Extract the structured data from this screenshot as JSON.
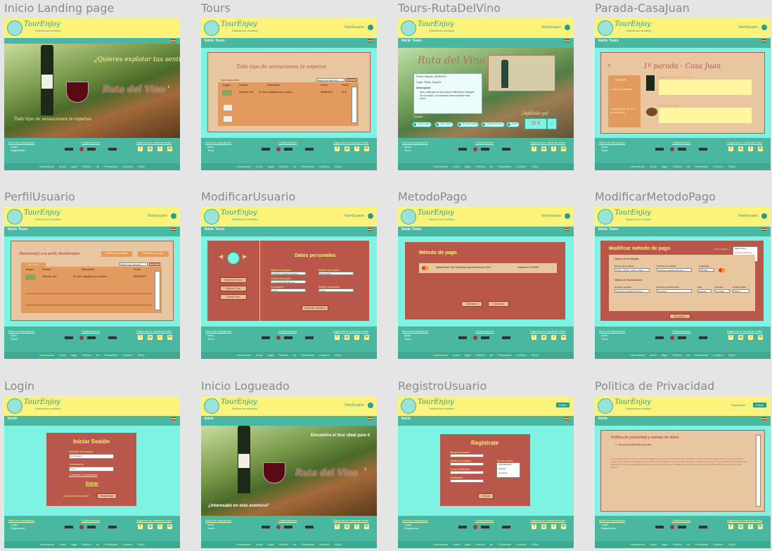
{
  "frames": [
    {
      "title": "Inicio Landing page"
    },
    {
      "title": "Tours"
    },
    {
      "title": "Tours-RutaDelVino"
    },
    {
      "title": "Parada-CasaJuan"
    },
    {
      "title": "PerfilUsuario"
    },
    {
      "title": "ModificarUsuario"
    },
    {
      "title": "MetodoPago"
    },
    {
      "title": "ModificarMetodoPago"
    },
    {
      "title": "Login"
    },
    {
      "title": "Inicio Logueado"
    },
    {
      "title": "RegistroUsuario"
    },
    {
      "title": "Politica de Privacidad"
    }
  ],
  "app": {
    "brand": "TourEnjoy",
    "tagline": "Disfruta tus sentidos",
    "username": "NomUsuario",
    "entrar": "Entrar",
    "registrarse": "Registrarse",
    "nav_inicio": "Inicio",
    "nav_tours": "Tours"
  },
  "footer": {
    "menu_title": "Menú de navegación",
    "menu_login": "Login",
    "menu_register": "Registrarse",
    "menu_inicio": "Inicio",
    "menu_tours": "Tours",
    "collab_title": "Colaboradores",
    "social_title": "Síguenos en nuestras redes",
    "legal": "Información Aviso legal Política de Privacidad Cookies FAQs"
  },
  "landing": {
    "headline": "¿Quieres explotar tus sentidos?",
    "ruta": "Ruta del Vino",
    "sub": "Todo tipo de sensaciones te esperan"
  },
  "tours": {
    "title": "Todo tipo de sensaciones te esperan",
    "tab": "Tours disponibles",
    "search": "Buscar tour deportivo",
    "search_btn": "Buscar",
    "col_imagen": "Imagen",
    "col_nombre": "Nombre",
    "col_desc": "Descripción",
    "col_fecha": "Fecha",
    "col_precio": "Precio",
    "row_nombre": "Ruta del vino",
    "row_desc": "En este magnífico tour podrás...",
    "row_fecha": "08/08/2021",
    "row_precio": "32 €"
  },
  "rutavino": {
    "title": "Ruta del Vino",
    "fecha": "Fecha: Sábado, 08/08/2021",
    "lugar": "Lugar: Toledo, España",
    "desc_label": "Descripción:",
    "desc": "Van a disfrutar de una cata en diferentes bodegas de la ciudad. Los sentidos nunca estarán más vivos...",
    "paradas": "Paradas:",
    "stops": [
      "Casa Juan",
      "Vino Tinto",
      "Buenas uvas",
      "Viñeda el buco",
      "Mura"
    ],
    "aplicable": "¡Aplícalo ya!",
    "price": "32 €"
  },
  "casajuan": {
    "title": "1ª parada - Casa Juan",
    "incluye": "Incluye",
    "inc1": "1 copa por persona",
    "inc2": "Productos con un 10% de descuento",
    "prod1": "Prosecco Cabrera 2016",
    "prod2": "Queso Curado"
  },
  "perfil": {
    "welcome": "Bienvenid@ a tu perfil, NomUsuario",
    "btn_datos": "Datos personales",
    "btn_pago": "Método de pago",
    "tab": "Mis Tours",
    "search": "Buscar tour deportivo",
    "search_btn": "Buscar",
    "col_imagen": "Imagen",
    "col_nombre": "Nombre",
    "col_desc": "Descripción",
    "col_fecha": "Fecha",
    "row_nombre": "Ruta del vino",
    "row_desc": "En este magnífico tour podrás...",
    "row_fecha": "08/08/2021"
  },
  "modusuario": {
    "title": "Datos personales",
    "btn_foto": "Modificar Foto",
    "btn_borrar": "Borrar Foto",
    "btn_subir": "Subir Foto",
    "f1": "Nombre completo",
    "v1": "Apellido1 Apellido2 Nombre",
    "f2": "Nombre de usuario",
    "v2": "NomUsuario",
    "f3": "Correo electrónico",
    "v3": "nomusuario@gmail.com",
    "f4": "Contraseña",
    "v4": "••••••••",
    "f5": "Repetir contraseña",
    "v5": "••••••••",
    "btn_guardar": "Guardar cambios"
  },
  "metodopago": {
    "title": "Método de pago",
    "card": "MasterCard • 46 / Expiración que termina en 2314",
    "exp": "Caduca el: 07/2022",
    "btn_eliminar": "Eliminar",
    "btn_guardar": "Guardar"
  },
  "modpago": {
    "title": "Modificar método de pago",
    "tipo": "Tipo de tarjeta",
    "opt1": "MasterCard",
    "opt2": "American Express",
    "opt3": "PayPal",
    "sec1": "Datos de la tarjeta",
    "f1": "Número de la tarjeta",
    "v1": "XXXX - XXXX - XXXX - 2314",
    "f2": "Nombre en la tarjeta",
    "v2": "Apellido1 Apellido2 Nombre",
    "f3": "Caducidad",
    "v3": "07/2022",
    "sec2": "Datos de facturación",
    "g1": "Nombre completo",
    "w1": "Apellido1 Apellido2 Nombre",
    "g2": "Dirección de facturación",
    "w2": "Dirección",
    "g3": "País",
    "w3": "España",
    "g4": "Provincia",
    "w4": "Granada",
    "g5": "Código postal",
    "w5": "18014",
    "btn": "Modificar"
  },
  "login": {
    "title": "Iniciar Sesión",
    "user_label": "Nombre de usuario",
    "user_val": "NomUsuario",
    "pass_label": "Contraseña",
    "pass_val": "••••••••",
    "forgot": "¿Olvidaste tu contraseña?",
    "entrar": "Entrar",
    "noacc": "¿Aún no tienes cuenta?",
    "reg": "Regístrate"
  },
  "logueado": {
    "headline": "Encuentra el tour ideal para ti",
    "ruta": "Ruta del Vino",
    "sub": "¿Interesado en esta aventura?"
  },
  "registro": {
    "title": "Regístrate",
    "f1": "Nombre completo",
    "f2": "Nombre de usuario",
    "f3": "Correo electrónico",
    "f4": "Contraseña",
    "f5": "Tipo de usuario",
    "opt1": "Administrador",
    "opt2": "Usuario",
    "opt3": "Comercio",
    "btn": "Enviar"
  },
  "privacidad": {
    "title": "Política de privacidad y manejo de datos",
    "sec": "1. Responsabilidad judicial",
    "body": "Lorem ipsum dolor sit amet, consectetur adipiscing elit, sed do eiusmod tempor incididunt ut labore et dolore magna aliqua. Ut enim ad minim veniam, quis nostrud exercitation ullamco laboris nisi ut aliquip ex ea commodo consequat. Duis aute irure dolor in reprehenderit in voluptate velit esse cillum dolore eu fugiat nulla pariatur. Excepteur sint occaecat cupidatat non proident, sunt in culpa qui officia deserunt mollit anim id est laborum."
  }
}
